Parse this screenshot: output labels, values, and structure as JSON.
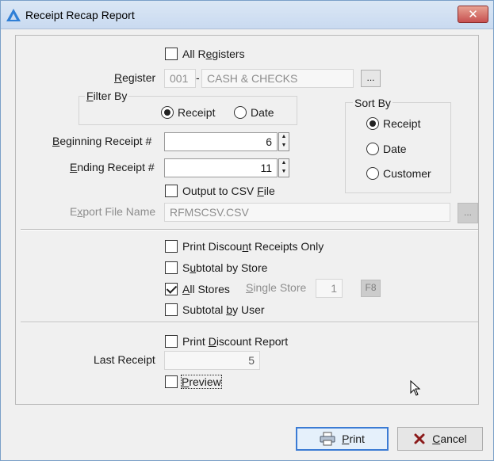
{
  "window": {
    "title": "Receipt Recap Report",
    "close_glyph": "✕"
  },
  "options": {
    "all_registers": {
      "label": "All Registers",
      "underline": "e",
      "checked": false
    }
  },
  "register": {
    "label_pre": "",
    "label_u": "R",
    "label_post": "egister",
    "code": "001",
    "separator": "-",
    "name": "CASH & CHECKS",
    "browse_label": "..."
  },
  "filter_by": {
    "title_u": "F",
    "title_post": "ilter By",
    "receipt_label": "Receipt",
    "date_label": "Date",
    "selected": "Receipt"
  },
  "sort_by": {
    "title": "Sort By",
    "receipt_label": "Receipt",
    "date_label": "Date",
    "customer_label": "Customer",
    "selected": "Receipt"
  },
  "beginning_receipt": {
    "label_u": "B",
    "label_post": "eginning Receipt #",
    "value": "6"
  },
  "ending_receipt": {
    "label_u": "E",
    "label_post": "nding Receipt #",
    "value": "11"
  },
  "csv": {
    "output_pre": "Output to CSV ",
    "output_u": "F",
    "output_post": "ile",
    "checked": false,
    "export_label_pre": "E",
    "export_label_u": "x",
    "export_label_post": "port File Name",
    "file_name": "RFMSCSV.CSV",
    "browse_label": "..."
  },
  "store_options": {
    "print_discount_receipts_pre": "Print Discou",
    "print_discount_receipts_u": "n",
    "print_discount_receipts_post": "t Receipts Only",
    "subtotal_store_pre": "S",
    "subtotal_store_u": "u",
    "subtotal_store_post": "btotal by Store",
    "all_stores_u": "A",
    "all_stores_post": "ll Stores",
    "all_stores_checked": true,
    "single_store_u": "S",
    "single_store_post": "ingle Store",
    "single_store_value": "1",
    "single_store_key": "F8",
    "subtotal_user_pre": "Subtotal ",
    "subtotal_user_u": "b",
    "subtotal_user_post": "y User"
  },
  "report": {
    "print_discount_pre": "Print ",
    "print_discount_u": "D",
    "print_discount_post": "iscount Report",
    "last_receipt_label": "Last Receipt",
    "last_receipt_value": "5",
    "preview_u": "P",
    "preview_post": "review",
    "preview_checked": false
  },
  "buttons": {
    "print_u": "P",
    "print_post": "rint",
    "cancel_u": "C",
    "cancel_post": "ancel"
  },
  "colors": {
    "accent": "#3b7bd4",
    "close": "#c75050",
    "cancel_icon": "#8b1a1a"
  }
}
